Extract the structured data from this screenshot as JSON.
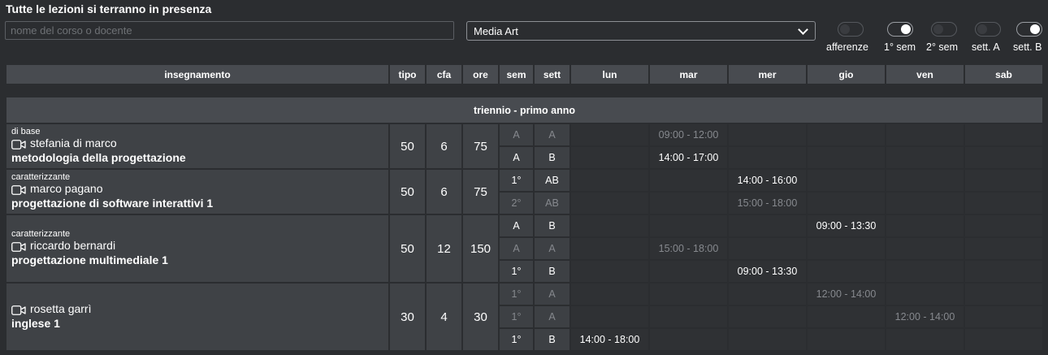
{
  "page": {
    "title": "Tutte le lezioni si terranno in presenza"
  },
  "search": {
    "placeholder": "nome del corso o docente",
    "value": ""
  },
  "filter": {
    "selected": "Media Art"
  },
  "toggles": [
    {
      "label": "afferenze",
      "on": false
    },
    {
      "label": "1° sem",
      "on": true
    },
    {
      "label": "2° sem",
      "on": false
    },
    {
      "label": "sett. A",
      "on": false
    },
    {
      "label": "sett. B",
      "on": true
    }
  ],
  "table": {
    "headers": [
      "insegnamento",
      "tipo",
      "cfa",
      "ore",
      "sem",
      "sett",
      "lun",
      "mar",
      "mer",
      "gio",
      "ven",
      "sab"
    ],
    "section": "triennio - primo anno",
    "courses": [
      {
        "category": "di base",
        "teacher": "stefania di marco",
        "course": "metodologia della progettazione",
        "tipo": "50",
        "cfa": "6",
        "ore": "75",
        "slots": [
          {
            "sem": "A",
            "sett": "A",
            "dim": true,
            "times": [
              "",
              "09:00 - 12:00",
              "",
              "",
              "",
              ""
            ]
          },
          {
            "sem": "A",
            "sett": "B",
            "dim": false,
            "times": [
              "",
              "14:00 - 17:00",
              "",
              "",
              "",
              ""
            ]
          }
        ]
      },
      {
        "category": "caratterizzante",
        "teacher": "marco pagano",
        "course": "progettazione di software interattivi 1",
        "tipo": "50",
        "cfa": "6",
        "ore": "75",
        "slots": [
          {
            "sem": "1°",
            "sett": "AB",
            "dim": false,
            "times": [
              "",
              "",
              "14:00 - 16:00",
              "",
              "",
              ""
            ]
          },
          {
            "sem": "2°",
            "sett": "AB",
            "dim": true,
            "times": [
              "",
              "",
              "15:00 - 18:00",
              "",
              "",
              ""
            ]
          }
        ]
      },
      {
        "category": "caratterizzante",
        "teacher": "riccardo bernardi",
        "course": "progettazione multimediale 1",
        "tipo": "50",
        "cfa": "12",
        "ore": "150",
        "slots": [
          {
            "sem": "A",
            "sett": "B",
            "dim": false,
            "times": [
              "",
              "",
              "",
              "09:00 - 13:30",
              "",
              ""
            ]
          },
          {
            "sem": "A",
            "sett": "A",
            "dim": true,
            "times": [
              "",
              "15:00 - 18:00",
              "",
              "",
              "",
              ""
            ]
          },
          {
            "sem": "1°",
            "sett": "B",
            "dim": false,
            "times": [
              "",
              "",
              "09:00 - 13:30",
              "",
              "",
              ""
            ]
          }
        ]
      },
      {
        "category": "",
        "teacher": "rosetta garrì",
        "course": "inglese 1",
        "tipo": "30",
        "cfa": "4",
        "ore": "30",
        "slots": [
          {
            "sem": "1°",
            "sett": "A",
            "dim": true,
            "times": [
              "",
              "",
              "",
              "12:00 - 14:00",
              "",
              ""
            ]
          },
          {
            "sem": "1°",
            "sett": "A",
            "dim": true,
            "times": [
              "",
              "",
              "",
              "",
              "12:00 - 14:00",
              ""
            ]
          },
          {
            "sem": "1°",
            "sett": "B",
            "dim": false,
            "times": [
              "14:00 - 18:00",
              "",
              "",
              "",
              "",
              ""
            ]
          }
        ]
      }
    ]
  },
  "colors": {
    "background": "#2b2d30",
    "cell": "#2f3134",
    "header": "#484b50",
    "info": "#3f4246",
    "dim_text": "#86898e"
  }
}
